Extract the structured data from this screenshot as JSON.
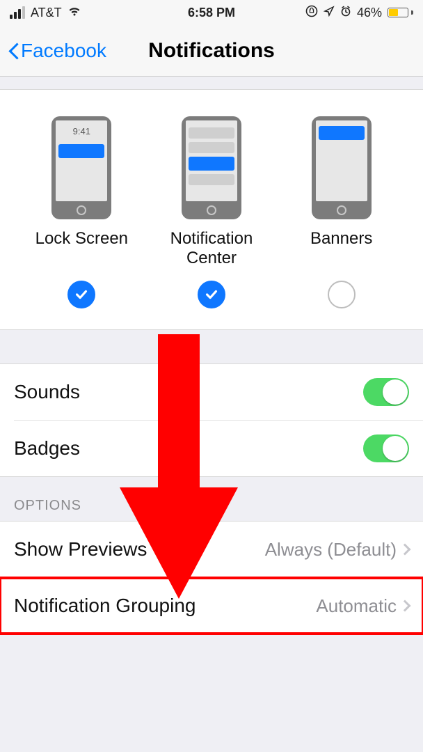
{
  "status": {
    "carrier": "AT&T",
    "time": "6:58 PM",
    "battery_percent": "46%"
  },
  "nav": {
    "back_label": "Facebook",
    "title": "Notifications"
  },
  "alertStyles": {
    "preview_time": "9:41",
    "items": [
      {
        "label": "Lock Screen",
        "checked": true
      },
      {
        "label": "Notification Center",
        "checked": true
      },
      {
        "label": "Banners",
        "checked": false
      }
    ]
  },
  "toggles": {
    "sounds_label": "Sounds",
    "sounds_on": true,
    "badges_label": "Badges",
    "badges_on": true
  },
  "options": {
    "header": "OPTIONS",
    "show_previews_label": "Show Previews",
    "show_previews_value": "Always (Default)",
    "grouping_label": "Notification Grouping",
    "grouping_value": "Automatic"
  }
}
